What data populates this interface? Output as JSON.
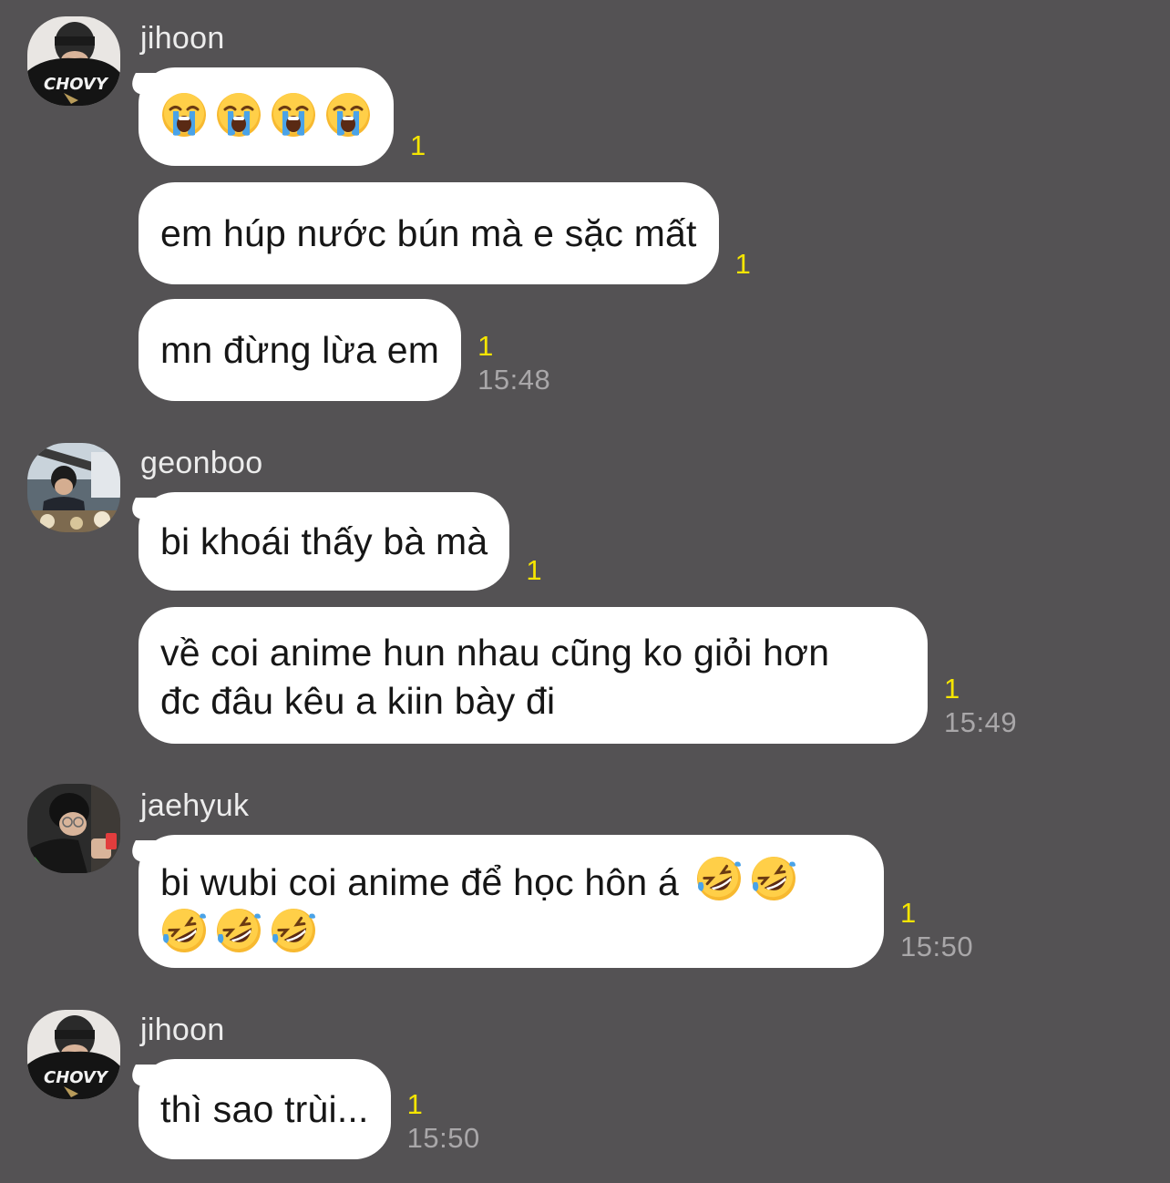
{
  "colors": {
    "background": "#545254",
    "bubble": "#ffffff",
    "message_text": "#161616",
    "sender_name": "#ececec",
    "unread_count": "#f5e500",
    "timestamp": "#a9a7a9"
  },
  "groups": [
    {
      "sender": "jihoon",
      "avatar": "avatar-photo-jihoon",
      "messages": [
        {
          "emojis": [
            "loudly-crying-face-icon",
            "loudly-crying-face-icon",
            "loudly-crying-face-icon",
            "loudly-crying-face-icon"
          ],
          "unread": "1",
          "time": ""
        },
        {
          "text": "em húp nước bún mà e sặc mất",
          "unread": "1",
          "time": ""
        },
        {
          "text": "mn đừng lừa em",
          "unread": "1",
          "time": "15:48"
        }
      ]
    },
    {
      "sender": "geonboo",
      "avatar": "avatar-photo-geonboo",
      "messages": [
        {
          "text": "bi khoái thấy bà mà",
          "unread": "1",
          "time": ""
        },
        {
          "line1": "về coi anime hun nhau cũng ko giỏi hơn",
          "line2": "đc đâu kêu a kiin bày đi",
          "unread": "1",
          "time": "15:49"
        }
      ]
    },
    {
      "sender": "jaehyuk",
      "avatar": "avatar-photo-jaehyuk",
      "messages": [
        {
          "text": "bi wubi coi anime để học hôn á",
          "emojis": [
            "rolling-on-floor-laughing-icon",
            "rolling-on-floor-laughing-icon",
            "rolling-on-floor-laughing-icon",
            "rolling-on-floor-laughing-icon",
            "rolling-on-floor-laughing-icon"
          ],
          "unread": "1",
          "time": "15:50"
        }
      ]
    },
    {
      "sender": "jihoon",
      "avatar": "avatar-photo-jihoon",
      "messages": [
        {
          "text": "thì sao trùi...",
          "unread": "1",
          "time": "15:50"
        }
      ]
    }
  ]
}
